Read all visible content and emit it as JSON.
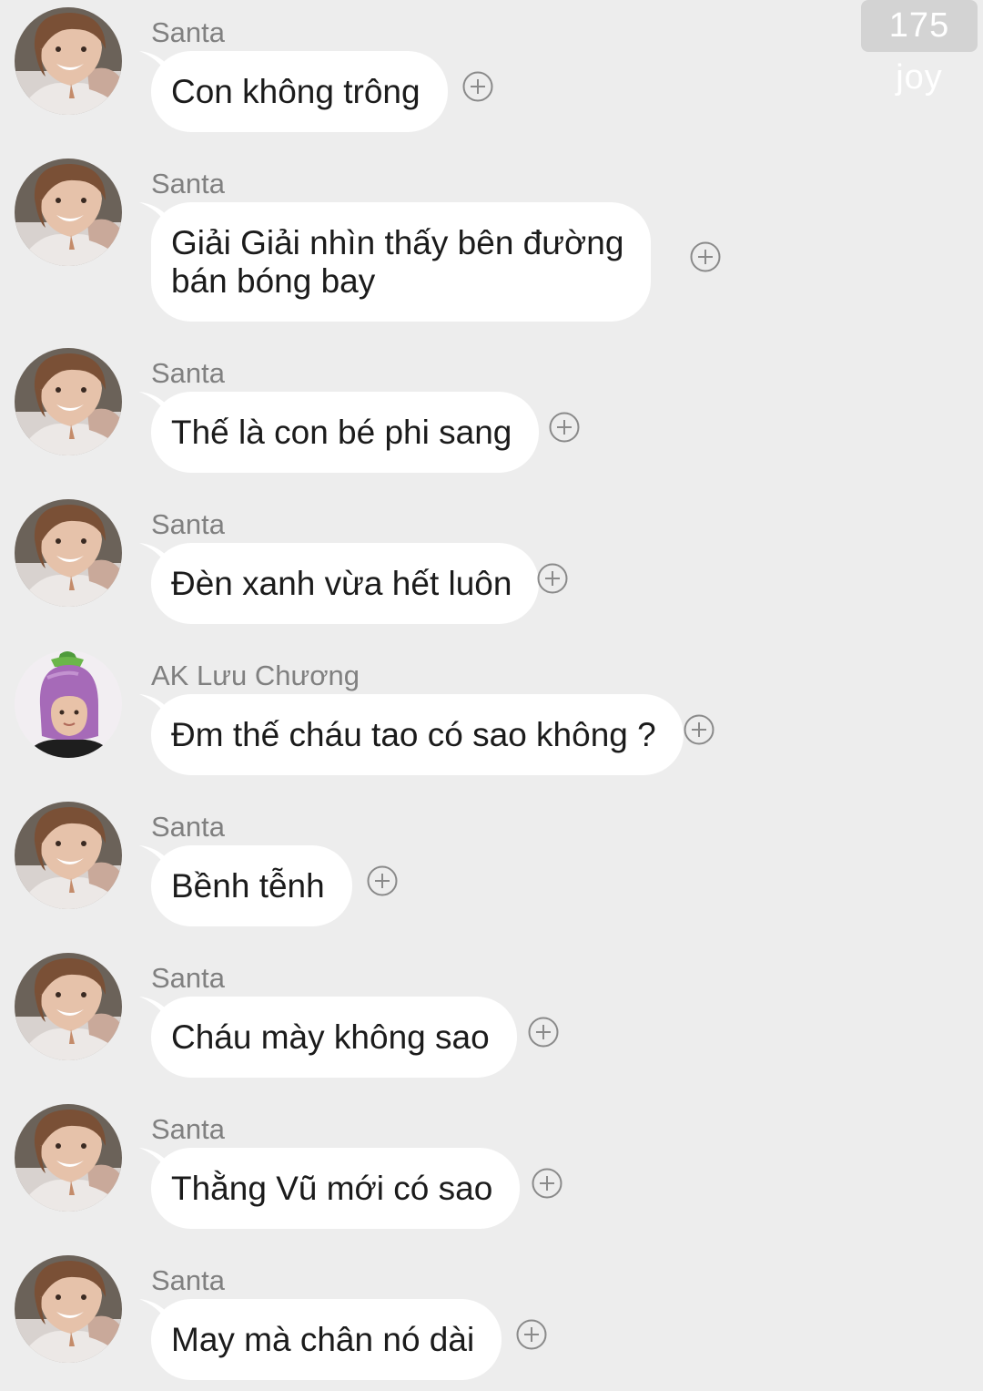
{
  "watermark": "175 joy",
  "icons": {
    "add_reaction": "plus-circle-icon",
    "avatar_santa": "avatar-photo-santa",
    "avatar_ak": "avatar-photo-eggplant-hat"
  },
  "colors": {
    "background": "#ededed",
    "bubble": "#ffffff",
    "sender": "#808080",
    "text": "#1b1b1b"
  },
  "messages": [
    {
      "sender": "Santa",
      "avatar": "santa",
      "text": "Con không trông"
    },
    {
      "sender": "Santa",
      "avatar": "santa",
      "text_line1": "Giải Giải nhìn thấy bên đường",
      "text_line2": "bán bóng bay"
    },
    {
      "sender": "Santa",
      "avatar": "santa",
      "text": "Thế là con bé phi sang"
    },
    {
      "sender": "Santa",
      "avatar": "santa",
      "text": "Đèn xanh vừa hết luôn"
    },
    {
      "sender": "AK Lưu Chương",
      "avatar": "ak",
      "text": "Đm thế cháu tao có sao không ?"
    },
    {
      "sender": "Santa",
      "avatar": "santa",
      "text": "Bềnh tễnh"
    },
    {
      "sender": "Santa",
      "avatar": "santa",
      "text": "Cháu mày không sao"
    },
    {
      "sender": "Santa",
      "avatar": "santa",
      "text": "Thằng Vũ mới có sao"
    },
    {
      "sender": "Santa",
      "avatar": "santa",
      "text": "May mà chân nó dài"
    }
  ]
}
